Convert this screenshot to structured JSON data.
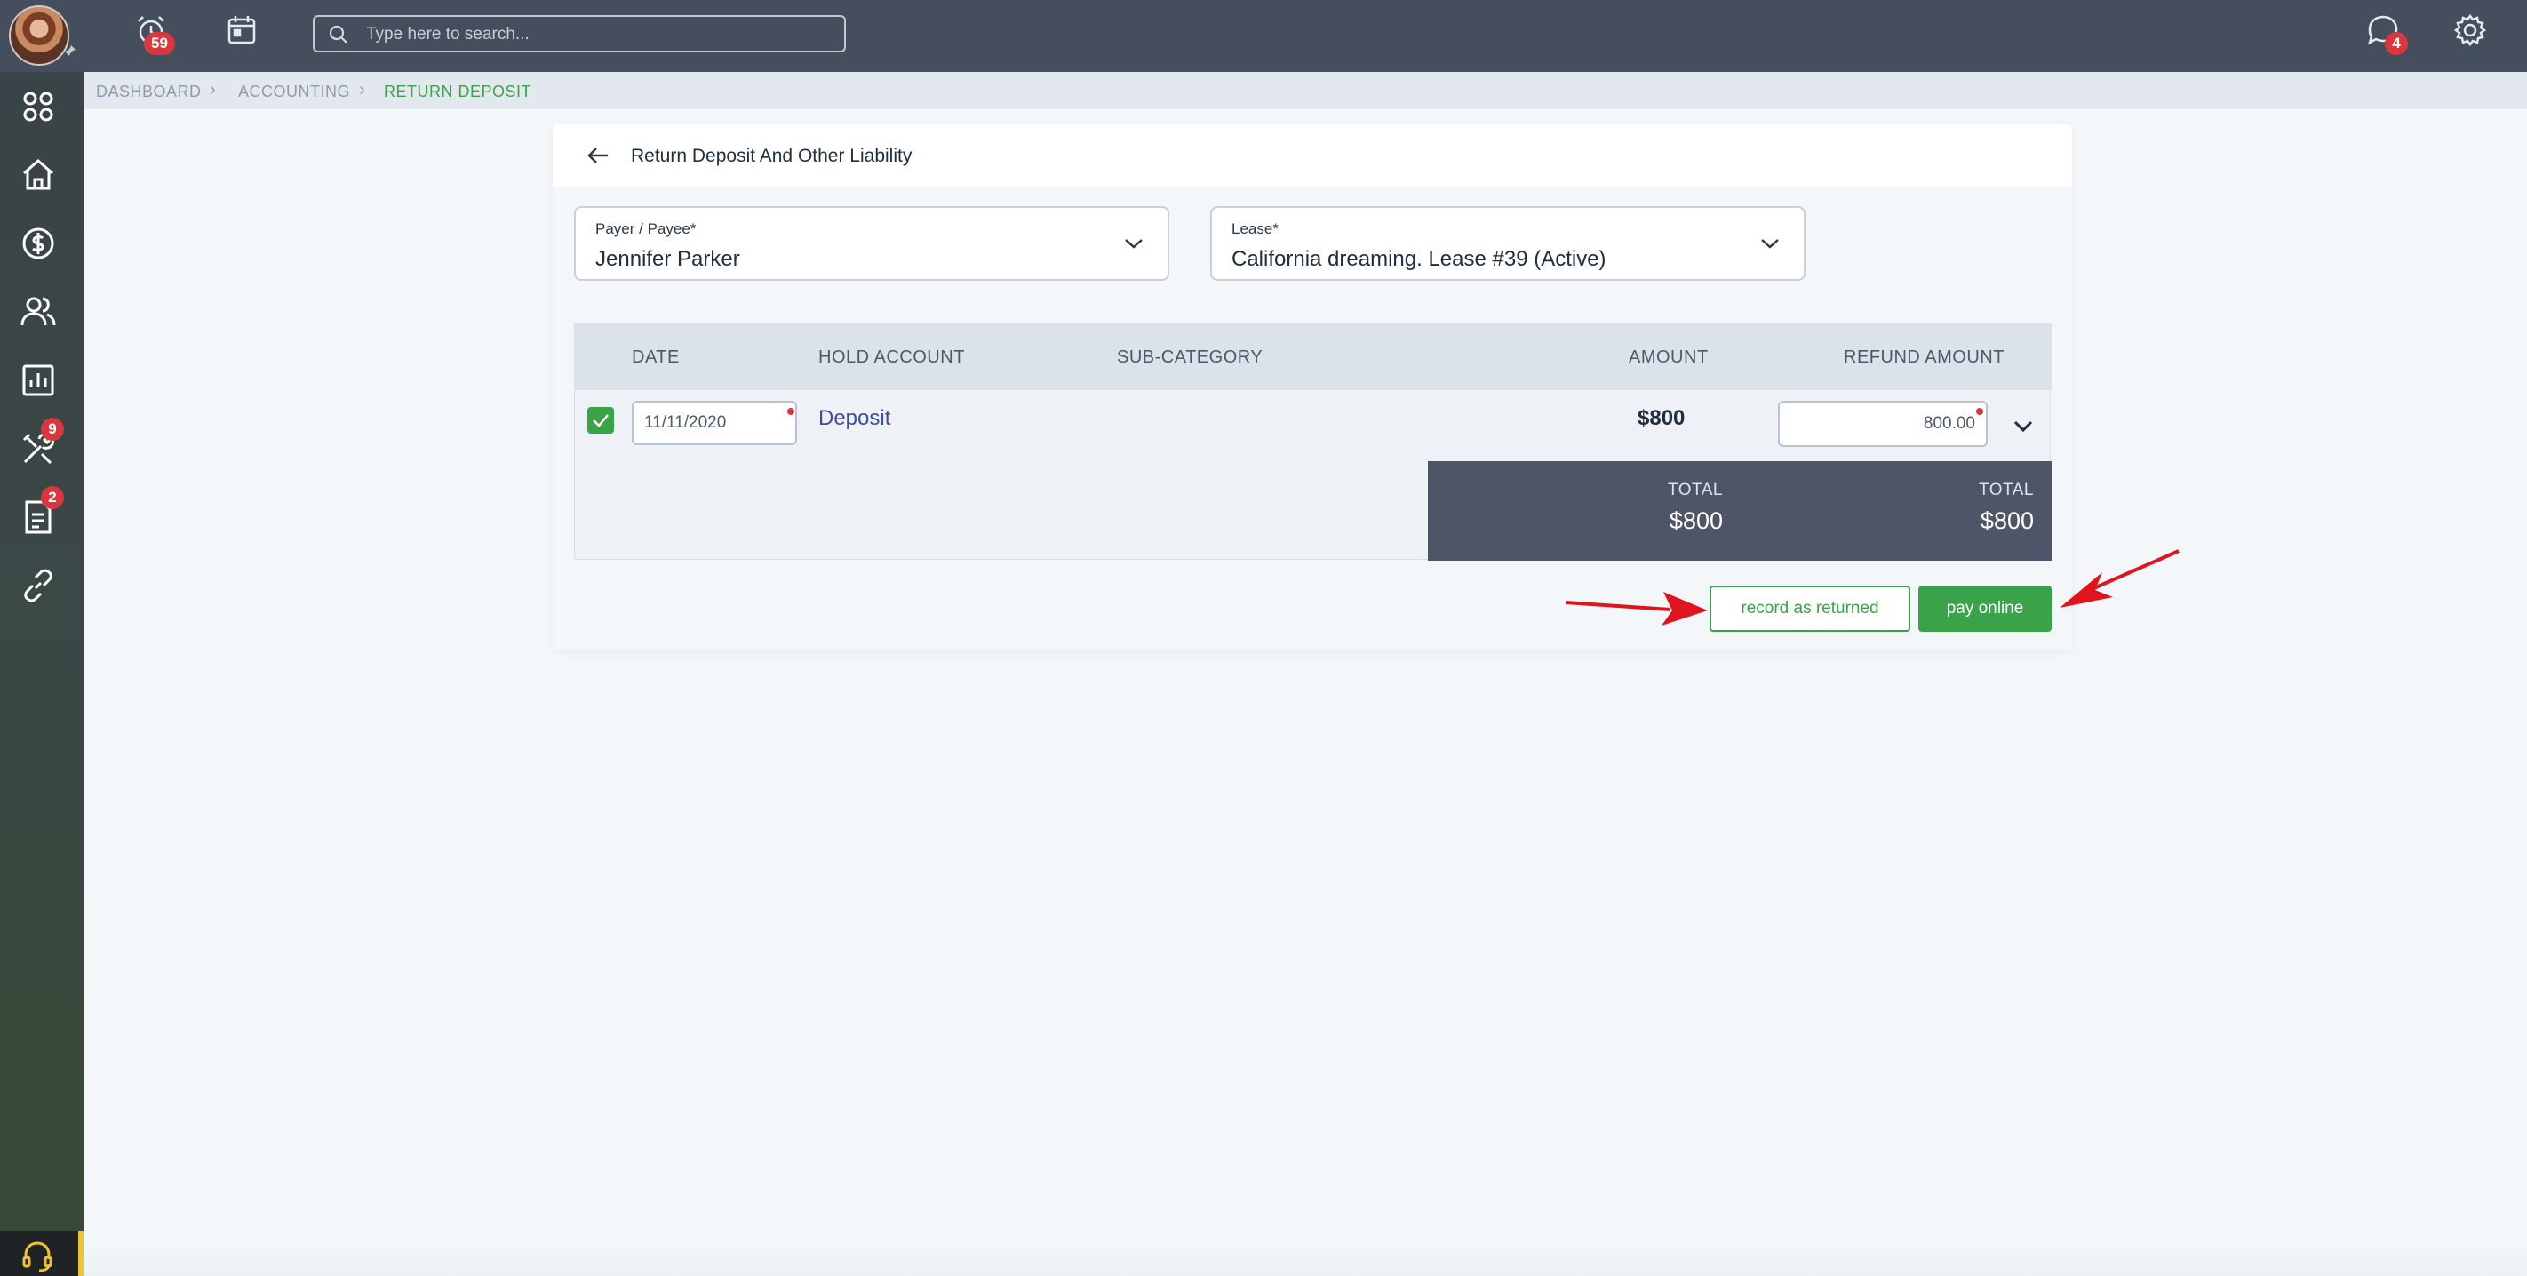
{
  "topbar": {
    "notifications_badge": "59",
    "search_placeholder": "Type here to search...",
    "messages_badge": "4"
  },
  "sidebar": {
    "items": [
      {
        "icon": "apps-grid-icon"
      },
      {
        "icon": "home-icon"
      },
      {
        "icon": "dollar-circle-icon"
      },
      {
        "icon": "people-icon"
      },
      {
        "icon": "bar-chart-icon"
      },
      {
        "icon": "tools-icon",
        "badge": "9"
      },
      {
        "icon": "document-icon",
        "badge": "2"
      },
      {
        "icon": "link-icon"
      }
    ],
    "support_icon": "headset-icon"
  },
  "breadcrumb": {
    "items": [
      "DASHBOARD",
      "ACCOUNTING",
      "RETURN DEPOSIT"
    ]
  },
  "page": {
    "title": "Return Deposit And Other Liability",
    "payer": {
      "label": "Payer / Payee*",
      "value": "Jennifer Parker"
    },
    "lease": {
      "label": "Lease*",
      "value": "California dreaming. Lease #39 (Active)"
    }
  },
  "table": {
    "headers": {
      "date": "DATE",
      "hold_account": "HOLD ACCOUNT",
      "sub_category": "SUB-CATEGORY",
      "amount": "AMOUNT",
      "refund_amount": "REFUND AMOUNT"
    },
    "rows": [
      {
        "checked": true,
        "date": "11/11/2020",
        "hold_account": "Deposit",
        "sub_category": "",
        "amount": "$800",
        "refund_amount": "800.00"
      }
    ],
    "totals": {
      "amount_label": "TOTAL",
      "amount_value": "$800",
      "refund_label": "TOTAL",
      "refund_value": "$800"
    }
  },
  "actions": {
    "record_label": "record as returned",
    "pay_label": "pay online"
  },
  "colors": {
    "accent_green": "#3aa34a",
    "topbar": "#454e5d",
    "badge_red": "#d9363e",
    "annotation_arrow": "#e0141c"
  }
}
